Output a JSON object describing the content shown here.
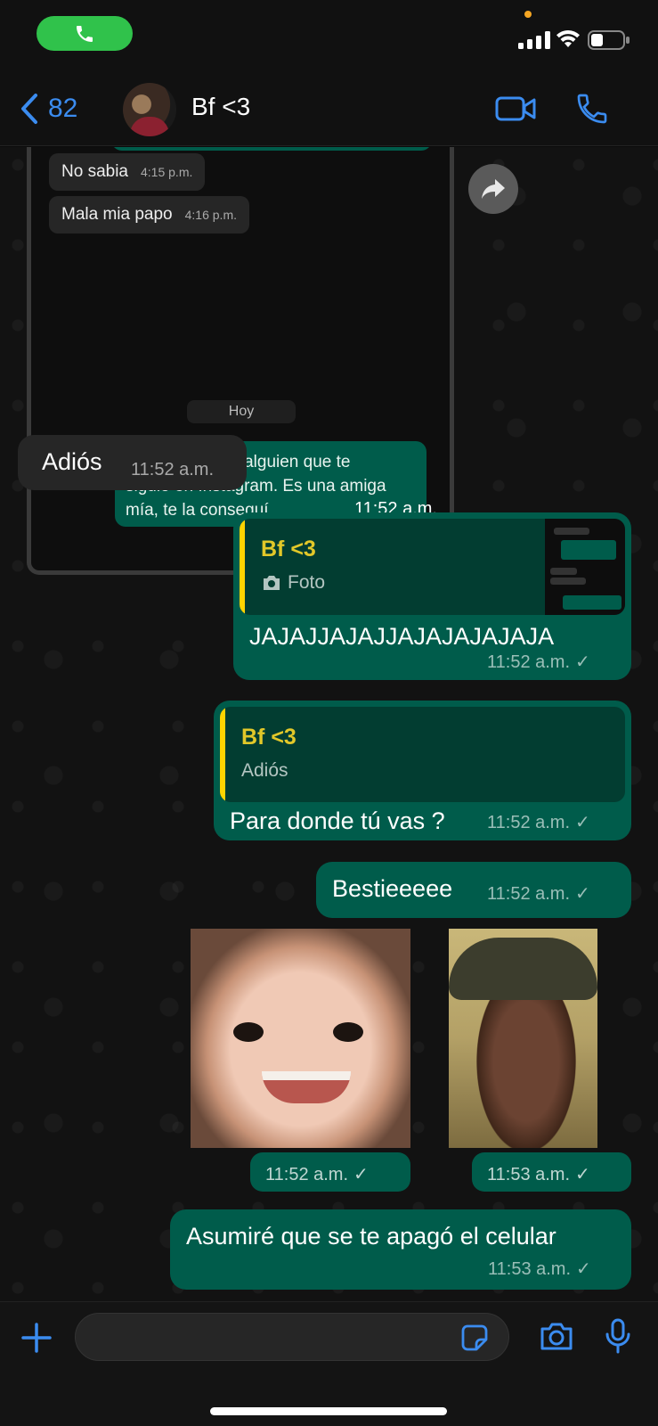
{
  "status_bar": {
    "call_icon": "phone-icon",
    "signal_icon": "signal-icon",
    "wifi_icon": "wifi-icon",
    "battery_icon": "battery-icon"
  },
  "header": {
    "back_count": "82",
    "contact_name": "Bf <3",
    "video_icon": "video-call-icon",
    "call_icon": "voice-call-icon"
  },
  "screenshot": {
    "messages": [
      {
        "text": "No sabia",
        "time": "4:15 p.m."
      },
      {
        "text": "Mala mia papo",
        "time": "4:16 p.m."
      }
    ],
    "date_label": "Hoy",
    "outgoing": {
      "text_line1": "Papo, acepta a alguien que te",
      "text_line2": "siguió en Instagram. Es una amiga",
      "text_line3": "mía, te la conseguí.",
      "time": "11:52 a.m."
    }
  },
  "messages": [
    {
      "id": "adios",
      "text": "Adiós",
      "time": "11:52 a.m."
    },
    {
      "id": "jaja",
      "quote_name": "Bf <3",
      "quote_text": "Foto",
      "text": "JAJAJJAJAJJAJAJAJAJAJA",
      "time": "11:52 a.m."
    },
    {
      "id": "para",
      "quote_name": "Bf <3",
      "quote_text": "Adiós",
      "text": "Para donde tú vas ?",
      "time": "11:52 a.m."
    },
    {
      "id": "bestie",
      "text": "Bestieeeee",
      "time": "11:52 a.m."
    },
    {
      "id": "photo1",
      "time": "11:52 a.m."
    },
    {
      "id": "photo2",
      "time": "11:53 a.m."
    },
    {
      "id": "asumire",
      "text": "Asumiré que se te apagó el celular",
      "time": "11:53 a.m."
    }
  ],
  "colors": {
    "accent": "#3b8cf0",
    "outgoing": "#005c4b",
    "incoming": "#262626",
    "quote_name": "#e2c829"
  },
  "input": {
    "placeholder": ""
  }
}
